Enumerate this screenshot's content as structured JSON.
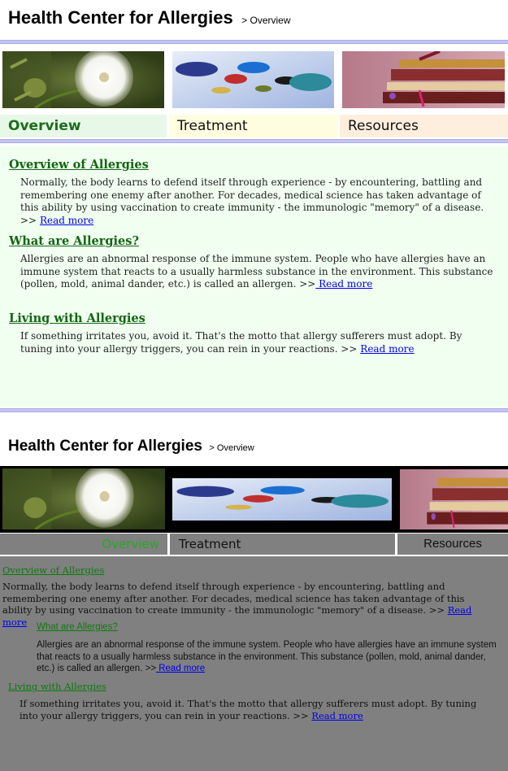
{
  "header": {
    "title": "Health Center for Allergies",
    "breadcrumb": "> Overview"
  },
  "images": [
    {
      "name": "dandelion",
      "alt": "dandelion flower"
    },
    {
      "name": "pills",
      "alt": "colorful pills"
    },
    {
      "name": "books",
      "alt": "stack of books"
    }
  ],
  "tabs": [
    {
      "label": "Overview",
      "active": true
    },
    {
      "label": "Treatment",
      "active": false
    },
    {
      "label": "Resources",
      "active": false
    }
  ],
  "sections": [
    {
      "title": "Overview of Allergies",
      "body": "Normally, the body learns to defend itself through experience - by encountering, battling and remembering one enemy after another. For decades, medical science has taken advantage of this ability by using vaccination to create immunity - the immunologic \"memory\" of a disease. >>",
      "link": "Read more"
    },
    {
      "title": "What are Allergies?",
      "body": "Allergies are an abnormal response of the immune system. People who have allergies have an immune system that reacts to a usually harmless substance in the environment. This substance (pollen, mold, animal dander, etc.) is called an allergen. >>",
      "link": " Read more"
    },
    {
      "title": "Living with Allergies",
      "body": "If something irritates you, avoid it. That's the motto that allergy sufferers must adopt. By tuning into your allergy triggers, you can rein in your reactions. >>",
      "link": "Read more"
    }
  ],
  "colors": {
    "accent_bar": "#c5c5f2",
    "overview_tab_bg": "#e8f8e8",
    "treatment_tab_bg": "#fffde0",
    "resources_tab_bg": "#fdeedd",
    "content_bg": "#f1fff1",
    "heading_green": "#116611",
    "degraded_gray": "#808080"
  }
}
